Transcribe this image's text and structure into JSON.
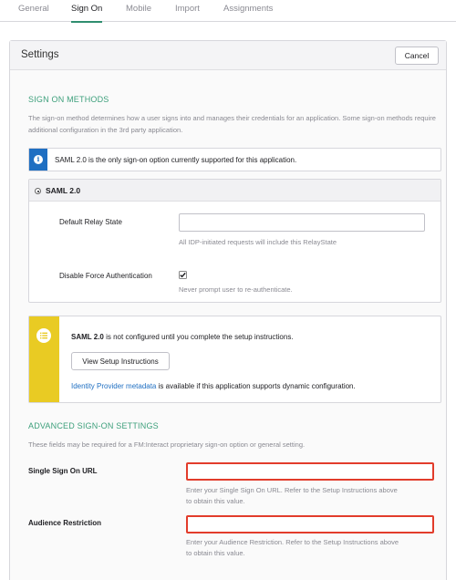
{
  "tabs": [
    {
      "label": "General"
    },
    {
      "label": "Sign On"
    },
    {
      "label": "Mobile"
    },
    {
      "label": "Import"
    },
    {
      "label": "Assignments"
    }
  ],
  "settings": {
    "title": "Settings",
    "cancel_label": "Cancel"
  },
  "sign_on_methods": {
    "heading": "SIGN ON METHODS",
    "description": "The sign-on method determines how a user signs into and manages their credentials for an application. Some sign-on methods require additional configuration in the 3rd party application.",
    "info_text": "SAML 2.0 is the only sign-on option currently supported for this application.",
    "info_icon": "info-icon"
  },
  "saml": {
    "option_label": "SAML 2.0",
    "relay_state_label": "Default Relay State",
    "relay_state_value": "",
    "relay_state_hint": "All IDP-initiated requests will include this RelayState",
    "force_auth_label": "Disable Force Authentication",
    "force_auth_checked": true,
    "force_auth_hint": "Never prompt user to re-authenticate."
  },
  "setup_notice": {
    "bold_text": "SAML 2.0",
    "text": " is not configured until you complete the setup instructions.",
    "button_label": "View Setup Instructions",
    "link_text": "Identity Provider metadata",
    "link_suffix": " is available if this application supports dynamic configuration."
  },
  "advanced": {
    "heading": "ADVANCED SIGN-ON SETTINGS",
    "description": "These fields may be required for a FM:Interact proprietary sign-on option or general setting.",
    "sso_url_label": "Single Sign On URL",
    "sso_url_value": "",
    "sso_url_hint_1": "Enter your Single Sign On URL. Refer to the Setup Instructions above",
    "sso_url_hint_2": "to obtain this value.",
    "audience_label": "Audience Restriction",
    "audience_value": "",
    "audience_hint_1": "Enter your Audience Restriction. Refer to the Setup Instructions above",
    "audience_hint_2": "to obtain this value."
  },
  "colors": {
    "accent": "#3ea07c",
    "info": "#1f6fc2",
    "warning": "#e9cb23",
    "error": "#e23c2b"
  }
}
